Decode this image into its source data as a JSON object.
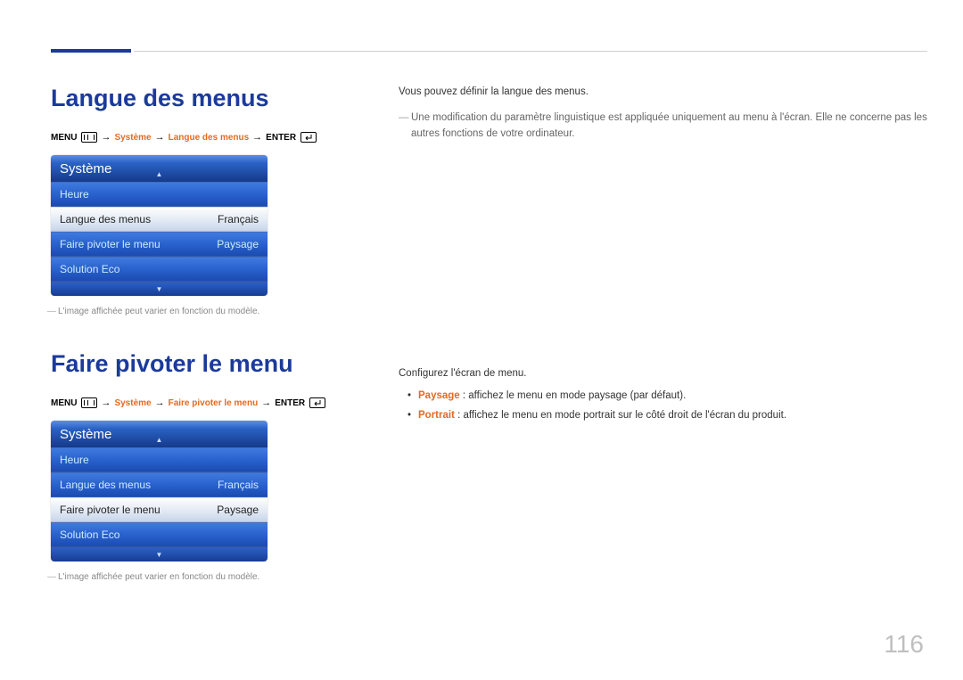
{
  "page_number": "116",
  "section1": {
    "heading": "Langue des menus",
    "breadcrumb": {
      "menu_label": "MENU",
      "system": "Système",
      "item": "Langue des menus",
      "enter_label": "ENTER"
    },
    "osd": {
      "title": "Système",
      "rows": [
        {
          "label": "Heure",
          "value": "",
          "selected": false
        },
        {
          "label": "Langue des menus",
          "value": "Français",
          "selected": true
        },
        {
          "label": "Faire pivoter le menu",
          "value": "Paysage",
          "selected": false
        },
        {
          "label": "Solution Eco",
          "value": "",
          "selected": false
        }
      ]
    },
    "footnote": "L'image affichée peut varier en fonction du modèle.",
    "body_intro": "Vous pouvez définir la langue des menus.",
    "body_note": "Une modification du paramètre linguistique est appliquée uniquement au menu à l'écran. Elle ne concerne pas les autres fonctions de votre ordinateur."
  },
  "section2": {
    "heading": "Faire pivoter le menu",
    "breadcrumb": {
      "menu_label": "MENU",
      "system": "Système",
      "item": "Faire pivoter le menu",
      "enter_label": "ENTER"
    },
    "osd": {
      "title": "Système",
      "rows": [
        {
          "label": "Heure",
          "value": "",
          "selected": false
        },
        {
          "label": "Langue des menus",
          "value": "Français",
          "selected": false
        },
        {
          "label": "Faire pivoter le menu",
          "value": "Paysage",
          "selected": true
        },
        {
          "label": "Solution Eco",
          "value": "",
          "selected": false
        }
      ]
    },
    "footnote": "L'image affichée peut varier en fonction du modèle.",
    "body_intro": "Configurez l'écran de menu.",
    "bullets": [
      {
        "keyword": "Paysage",
        "text": " : affichez le menu en mode paysage (par défaut)."
      },
      {
        "keyword": "Portrait",
        "text": " : affichez le menu en mode portrait sur le côté droit de l'écran du produit."
      }
    ]
  }
}
